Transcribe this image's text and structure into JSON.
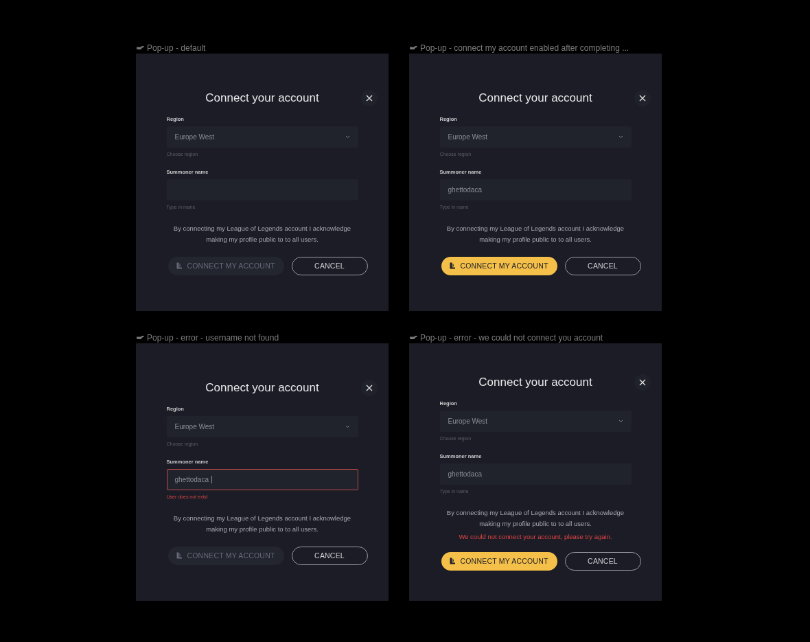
{
  "frames": [
    {
      "label": "Pop-up - default",
      "title": "Connect your account",
      "region": {
        "label": "Region",
        "value": "Europe West",
        "hint": "Choose region"
      },
      "summoner": {
        "label": "Summoner name",
        "focused": false,
        "invalid": false,
        "hint": "Type in name"
      },
      "disclaimer": "By connecting my League of Legends account I acknowledge making my profile public to to all users.",
      "connect_button": {
        "label": "CONNECT MY ACCOUNT",
        "disabled": true
      },
      "cancel_button": {
        "label": "CANCEL"
      }
    },
    {
      "label": "Pop-up - connect my account enabled after completing ...",
      "title": "Connect your account",
      "region": {
        "label": "Region",
        "value": "Europe West",
        "hint": "Choose region"
      },
      "summoner": {
        "label": "Summoner name",
        "value": "ghettodaca",
        "focused": false,
        "invalid": false,
        "hint": "Type in name"
      },
      "disclaimer": "By connecting my League of Legends account I acknowledge making my profile public to to all users.",
      "connect_button": {
        "label": "CONNECT MY ACCOUNT",
        "disabled": false
      },
      "cancel_button": {
        "label": "CANCEL"
      }
    },
    {
      "label": "Pop-up - error - username not found",
      "title": "Connect your account",
      "region": {
        "label": "Region",
        "value": "Europe West",
        "hint": "Choose region"
      },
      "summoner": {
        "label": "Summoner name",
        "value": "ghettodaca",
        "focused": true,
        "invalid": true,
        "hint": "User does not exist"
      },
      "disclaimer": "By connecting my League of Legends account I acknowledge making my profile public to to all users.",
      "connect_button": {
        "label": "CONNECT MY ACCOUNT",
        "disabled": true
      },
      "cancel_button": {
        "label": "CANCEL"
      }
    },
    {
      "label": "Pop-up - error - we could not connect you account",
      "title": "Connect your account",
      "region": {
        "label": "Region",
        "value": "Europe West",
        "hint": "Choose region"
      },
      "summoner": {
        "label": "Summoner name",
        "value": "ghettodaca",
        "focused": false,
        "invalid": false,
        "hint": "Type in name"
      },
      "disclaimer": "By connecting my League of Legends account I acknowledge making my profile public to to all users.",
      "error_message": "We could not connect your account, please try again.",
      "connect_button": {
        "label": "CONNECT MY ACCOUNT",
        "disabled": false
      },
      "cancel_button": {
        "label": "CANCEL"
      }
    }
  ]
}
